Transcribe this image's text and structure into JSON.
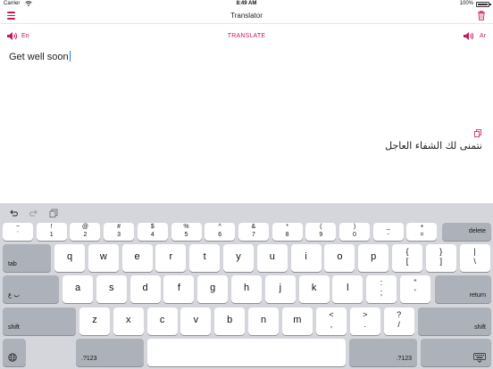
{
  "status_bar": {
    "carrier": "Carrier",
    "time": "8:49 AM",
    "battery": "100%"
  },
  "navbar": {
    "title": "Translator",
    "accent_color": "#c8175e"
  },
  "languages": {
    "source_label": "En",
    "target_label": "Ar",
    "translate_label": "TRANSLATE"
  },
  "input": {
    "text": "Get well soon"
  },
  "output": {
    "text": "نتمنى لك الشفاء العاجل"
  },
  "keyboard": {
    "number_row": [
      {
        "top": "~",
        "bottom": "`"
      },
      {
        "top": "!",
        "bottom": "1"
      },
      {
        "top": "@",
        "bottom": "2"
      },
      {
        "top": "#",
        "bottom": "3"
      },
      {
        "top": "$",
        "bottom": "4"
      },
      {
        "top": "%",
        "bottom": "5"
      },
      {
        "top": "^",
        "bottom": "6"
      },
      {
        "top": "&",
        "bottom": "7"
      },
      {
        "top": "*",
        "bottom": "8"
      },
      {
        "top": "(",
        "bottom": "9"
      },
      {
        "top": ")",
        "bottom": "0"
      },
      {
        "top": "_",
        "bottom": "-"
      },
      {
        "top": "+",
        "bottom": "="
      }
    ],
    "delete_label": "delete",
    "tab_label": "tab",
    "row_q": [
      "q",
      "w",
      "e",
      "r",
      "t",
      "y",
      "u",
      "i",
      "o",
      "p"
    ],
    "row_q_extra": [
      {
        "top": "{",
        "bottom": "["
      },
      {
        "top": "}",
        "bottom": "]"
      },
      {
        "top": "|",
        "bottom": "\\"
      }
    ],
    "lang_switch_label": "ب ع",
    "row_a": [
      "a",
      "s",
      "d",
      "f",
      "g",
      "h",
      "j",
      "k",
      "l"
    ],
    "row_a_extra": [
      {
        "top": ":",
        "bottom": ";"
      },
      {
        "top": "\"",
        "bottom": "'"
      }
    ],
    "return_label": "return",
    "shift_label": "shift",
    "row_z": [
      "z",
      "x",
      "c",
      "v",
      "b",
      "n",
      "m"
    ],
    "row_z_extra": [
      {
        "top": "<",
        "bottom": ","
      },
      {
        "top": ">",
        "bottom": "."
      },
      {
        "top": "?",
        "bottom": "/"
      }
    ],
    "numbers_label": ".?123",
    "globe_icon": "globe-icon",
    "dismiss_icon": "keyboard-dismiss-icon"
  }
}
